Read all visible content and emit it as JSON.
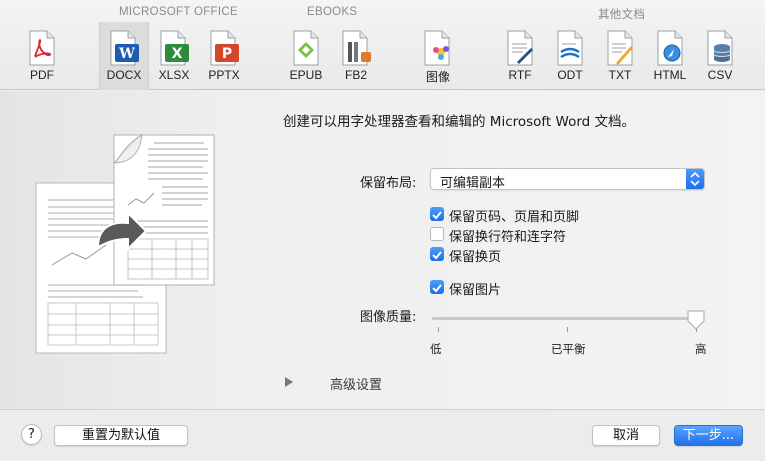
{
  "toolbar": {
    "groups": [
      {
        "label": "MICROSOFT OFFICE"
      },
      {
        "label": "EBOOKS"
      },
      {
        "label": "其他文档"
      }
    ],
    "formats": [
      {
        "label": "PDF",
        "icon": "pdf-icon",
        "selected": false
      },
      {
        "label": "DOCX",
        "icon": "docx-icon",
        "selected": true
      },
      {
        "label": "XLSX",
        "icon": "xlsx-icon",
        "selected": false
      },
      {
        "label": "PPTX",
        "icon": "pptx-icon",
        "selected": false
      },
      {
        "label": "EPUB",
        "icon": "epub-icon",
        "selected": false
      },
      {
        "label": "FB2",
        "icon": "fb2-icon",
        "selected": false
      },
      {
        "label": "图像",
        "icon": "image-icon",
        "selected": false
      },
      {
        "label": "RTF",
        "icon": "rtf-icon",
        "selected": false
      },
      {
        "label": "ODT",
        "icon": "odt-icon",
        "selected": false
      },
      {
        "label": "TXT",
        "icon": "txt-icon",
        "selected": false
      },
      {
        "label": "HTML",
        "icon": "html-icon",
        "selected": false
      },
      {
        "label": "CSV",
        "icon": "csv-icon",
        "selected": false
      }
    ]
  },
  "main": {
    "description": "创建可以用字处理器查看和编辑的 Microsoft Word 文档。",
    "layout_label": "保留布局:",
    "layout_value": "可编辑副本",
    "options": [
      {
        "label": "保留页码、页眉和页脚",
        "checked": true
      },
      {
        "label": "保留换行符和连字符",
        "checked": false
      },
      {
        "label": "保留换页",
        "checked": true
      },
      {
        "label": "保留图片",
        "checked": true
      }
    ],
    "image_quality_label": "图像质量:",
    "image_quality": {
      "low": "低",
      "mid": "已平衡",
      "high": "高",
      "level": 1.0
    },
    "advanced_label": "高级设置"
  },
  "footer": {
    "help": "?",
    "reset": "重置为默认值",
    "cancel": "取消",
    "next": "下一步..."
  },
  "colors": {
    "accent": "#1f72ea",
    "checkbox": "#2a7ef0"
  }
}
